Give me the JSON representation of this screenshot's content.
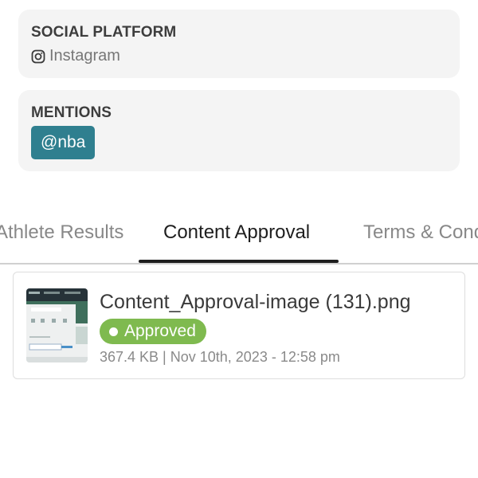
{
  "social_platform": {
    "label": "SOCIAL PLATFORM",
    "icon": "instagram-icon",
    "value": "Instagram"
  },
  "mentions": {
    "label": "MENTIONS",
    "chip": "@nba",
    "chip_color": "#2f7f8f"
  },
  "tabs": [
    {
      "label": "Athlete Results",
      "active": false
    },
    {
      "label": "Content Approval",
      "active": true
    },
    {
      "label": "Terms & Conditions",
      "active": false
    }
  ],
  "file": {
    "name": "Content_Approval-image (131).png",
    "status": "Approved",
    "status_color": "#7fba4f",
    "meta": "367.4 KB | Nov 10th, 2023 - 12:58 pm"
  }
}
